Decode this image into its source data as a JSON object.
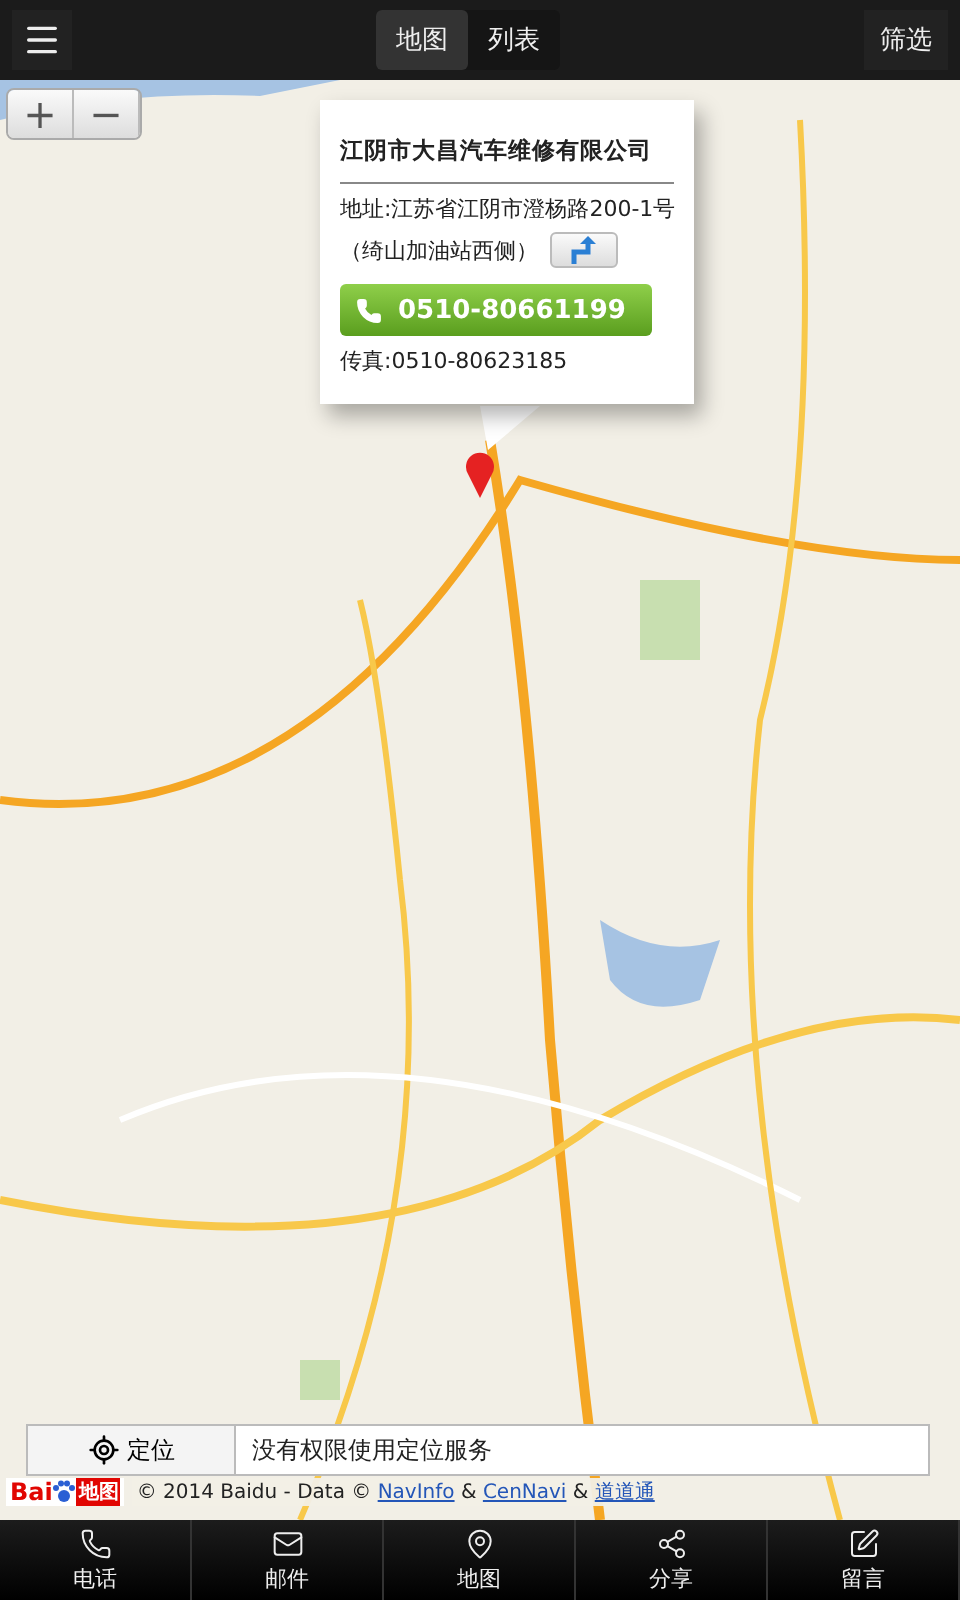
{
  "top_bar": {
    "tabs": [
      {
        "label": "地图",
        "selected": true
      },
      {
        "label": "列表",
        "selected": false
      }
    ],
    "filter": "筛选"
  },
  "zoom": {
    "plus": "+",
    "minus": "−"
  },
  "popup": {
    "title": "江阴市大昌汽车维修有限公司",
    "address": "地址:江苏省江阴市澄杨路200-1号",
    "address_note": "（绮山加油站西侧）",
    "phone": "0510-80661199",
    "fax": "传真:0510-80623185"
  },
  "locate": {
    "button": "定位",
    "message": "没有权限使用定位服务"
  },
  "attribution": {
    "logo_left": "Bai",
    "logo_right": "地图",
    "text": "© 2014 Baidu - Data ©",
    "links": [
      {
        "label": "NavInfo"
      },
      {
        "label": "CenNavi"
      },
      {
        "label": "道道通"
      }
    ],
    "separator": "&"
  },
  "bottom_nav": [
    {
      "kind": "phone",
      "label": "电话"
    },
    {
      "kind": "mail",
      "label": "邮件"
    },
    {
      "kind": "map",
      "label": "地图"
    },
    {
      "kind": "share",
      "label": "分享"
    },
    {
      "kind": "note",
      "label": "留言"
    }
  ]
}
